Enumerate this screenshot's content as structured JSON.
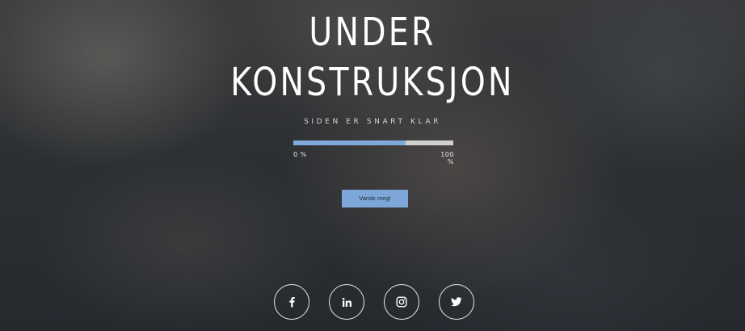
{
  "hero": {
    "title_line1": "UNDER",
    "title_line2": "KONSTRUKSJON",
    "subtitle": "SIDEN ER SNART KLAR"
  },
  "progress": {
    "value_fraction": 0.7,
    "start_label": "0 %",
    "end_label": "100 %",
    "fill_color": "#7fa9dc",
    "track_color": "#cfcfcf"
  },
  "notify_button": {
    "label": "Varsle meg!",
    "color": "#7da7d8"
  },
  "social_links": [
    {
      "icon": "facebook-icon"
    },
    {
      "icon": "linkedin-icon"
    },
    {
      "icon": "instagram-icon"
    },
    {
      "icon": "twitter-icon"
    }
  ]
}
